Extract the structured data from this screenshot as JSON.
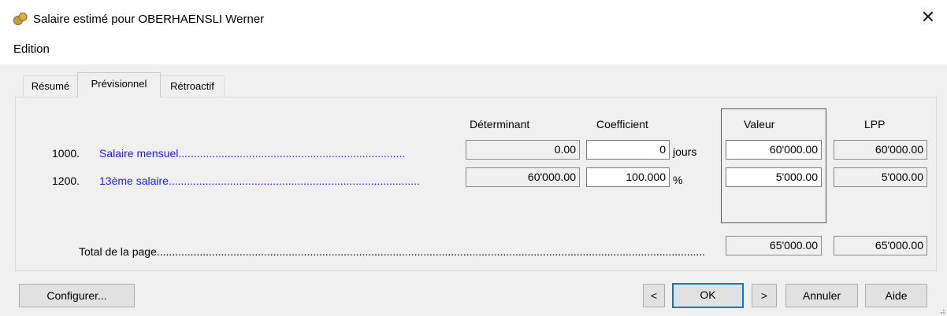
{
  "window": {
    "title": "Salaire estimé pour OBERHAENSLI Werner",
    "close_symbol": "✕"
  },
  "menu": {
    "edition": "Edition"
  },
  "tabs": [
    {
      "label": "Résumé",
      "active": false
    },
    {
      "label": "Prévisionnel",
      "active": true
    },
    {
      "label": "Rétroactif",
      "active": false
    }
  ],
  "columns": {
    "determinant": "Déterminant",
    "coefficient": "Coefficient",
    "valeur": "Valeur",
    "lpp": "LPP"
  },
  "rows": [
    {
      "code": "1000.",
      "label": "Salaire mensuel..........................................................................",
      "determinant": "0.00",
      "coefficient": "0",
      "unit": "jours",
      "valeur": "60'000.00",
      "lpp": "60'000.00"
    },
    {
      "code": "1200.",
      "label": "13ème salaire..................................................................................",
      "determinant": "60'000.00",
      "coefficient": "100.000",
      "unit": "%",
      "valeur": "5'000.00",
      "lpp": "5'000.00"
    }
  ],
  "total": {
    "label": "Total de la page.....................................................................................................................................................................................................",
    "valeur": "65'000.00",
    "lpp": "65'000.00"
  },
  "buttons": {
    "configurer": "Configurer...",
    "prev": "<",
    "ok": "OK",
    "next": ">",
    "annuler": "Annuler",
    "aide": "Aide"
  },
  "icons": {
    "app": "app-coins-icon",
    "close": "close-icon",
    "grip": "resize-grip-icon"
  },
  "colors": {
    "link": "#1a1aff",
    "dialog_bg": "#f0f0f0",
    "default_button_border": "#0078d7"
  }
}
